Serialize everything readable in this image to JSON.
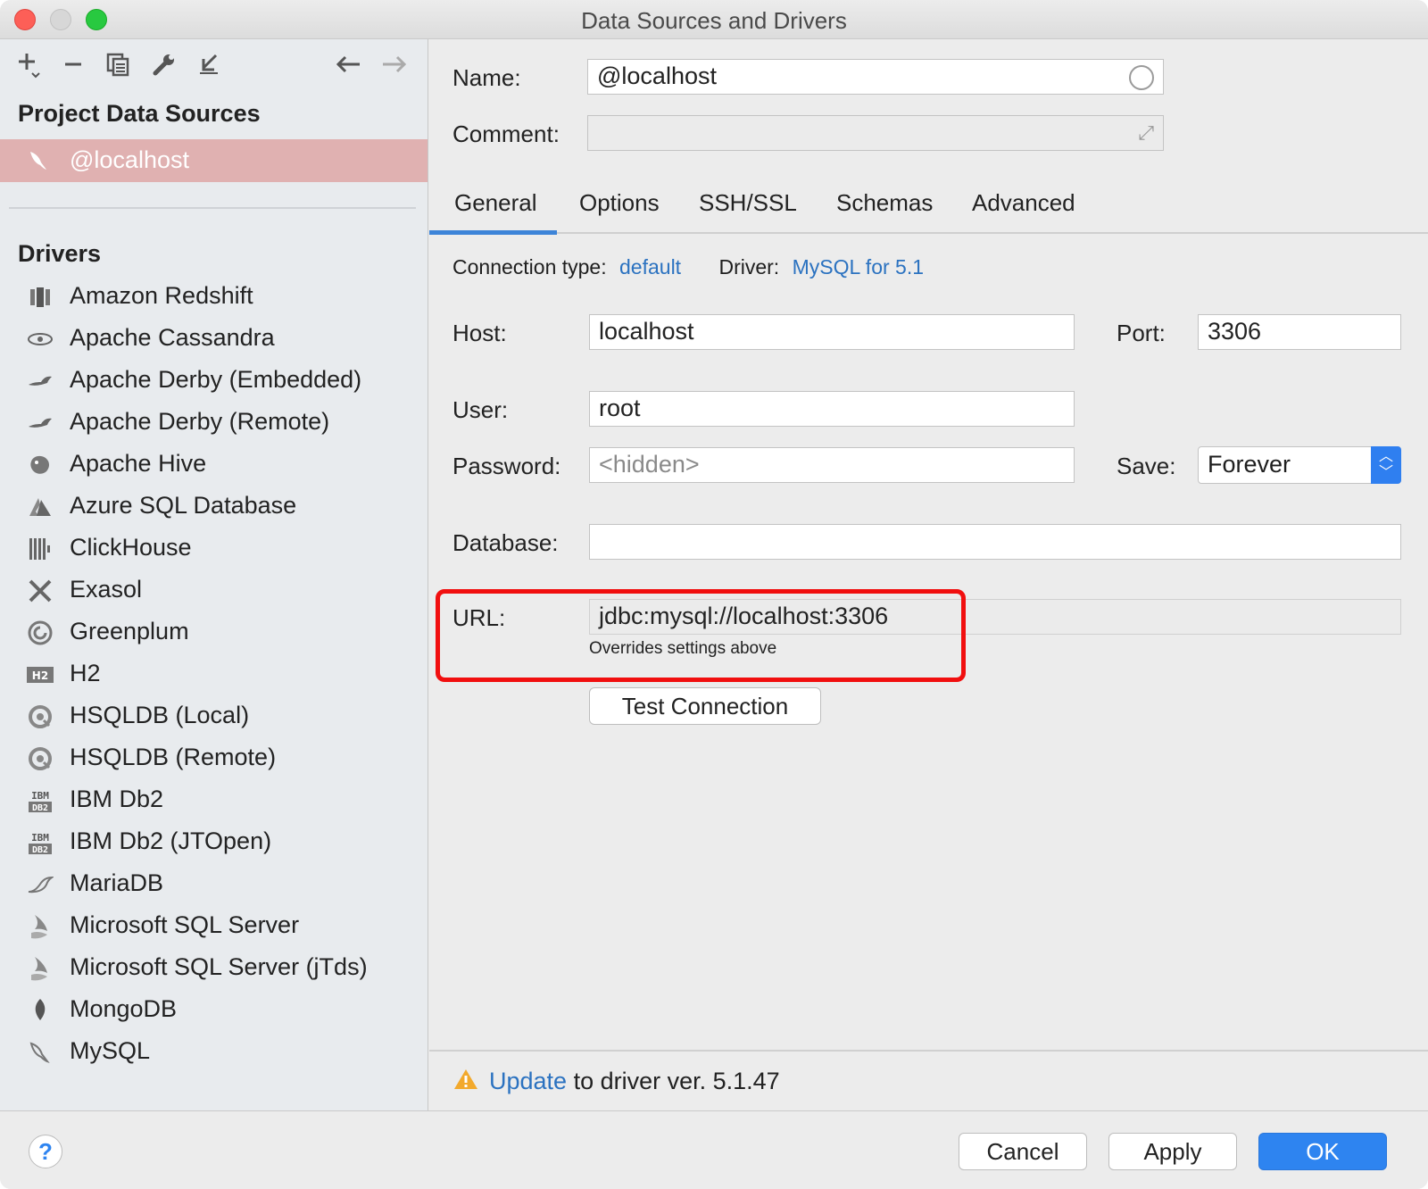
{
  "window": {
    "title": "Data Sources and Drivers"
  },
  "left": {
    "project_title": "Project Data Sources",
    "selected_source": "@localhost",
    "drivers_title": "Drivers",
    "drivers": [
      {
        "label": "Amazon Redshift",
        "icon": "redshift-icon"
      },
      {
        "label": "Apache Cassandra",
        "icon": "cassandra-icon"
      },
      {
        "label": "Apache Derby (Embedded)",
        "icon": "derby-icon"
      },
      {
        "label": "Apache Derby (Remote)",
        "icon": "derby-icon"
      },
      {
        "label": "Apache Hive",
        "icon": "hive-icon"
      },
      {
        "label": "Azure SQL Database",
        "icon": "azure-icon"
      },
      {
        "label": "ClickHouse",
        "icon": "clickhouse-icon"
      },
      {
        "label": "Exasol",
        "icon": "exasol-icon"
      },
      {
        "label": "Greenplum",
        "icon": "greenplum-icon"
      },
      {
        "label": "H2",
        "icon": "h2-icon"
      },
      {
        "label": "HSQLDB (Local)",
        "icon": "hsqldb-icon"
      },
      {
        "label": "HSQLDB (Remote)",
        "icon": "hsqldb-icon"
      },
      {
        "label": "IBM Db2",
        "icon": "db2-icon"
      },
      {
        "label": "IBM Db2 (JTOpen)",
        "icon": "db2-icon"
      },
      {
        "label": "MariaDB",
        "icon": "mariadb-icon"
      },
      {
        "label": "Microsoft SQL Server",
        "icon": "sqlserver-icon"
      },
      {
        "label": "Microsoft SQL Server (jTds)",
        "icon": "sqlserver-icon"
      },
      {
        "label": "MongoDB",
        "icon": "mongodb-icon"
      },
      {
        "label": "MySQL",
        "icon": "mysql-icon"
      }
    ]
  },
  "form": {
    "name_label": "Name:",
    "name_value": "@localhost",
    "comment_label": "Comment:",
    "comment_value": "",
    "tabs": [
      "General",
      "Options",
      "SSH/SSL",
      "Schemas",
      "Advanced"
    ],
    "active_tab": "General",
    "connection_type_label": "Connection type:",
    "connection_type_value": "default",
    "driver_label": "Driver:",
    "driver_value": "MySQL for 5.1",
    "host_label": "Host:",
    "host_value": "localhost",
    "port_label": "Port:",
    "port_value": "3306",
    "user_label": "User:",
    "user_value": "root",
    "password_label": "Password:",
    "password_placeholder": "<hidden>",
    "save_label": "Save:",
    "save_value": "Forever",
    "database_label": "Database:",
    "database_value": "",
    "url_label": "URL:",
    "url_value": "jdbc:mysql://localhost:3306",
    "url_hint": "Overrides settings above",
    "test_button": "Test Connection"
  },
  "warning": {
    "link": "Update",
    "text": " to driver ver. 5.1.47"
  },
  "footer": {
    "cancel": "Cancel",
    "apply": "Apply",
    "ok": "OK",
    "help": "?"
  },
  "colors": {
    "selection": "#e0b1b1",
    "link": "#2b72c0",
    "primary": "#2e84f0",
    "highlight": "#f10f0f"
  }
}
